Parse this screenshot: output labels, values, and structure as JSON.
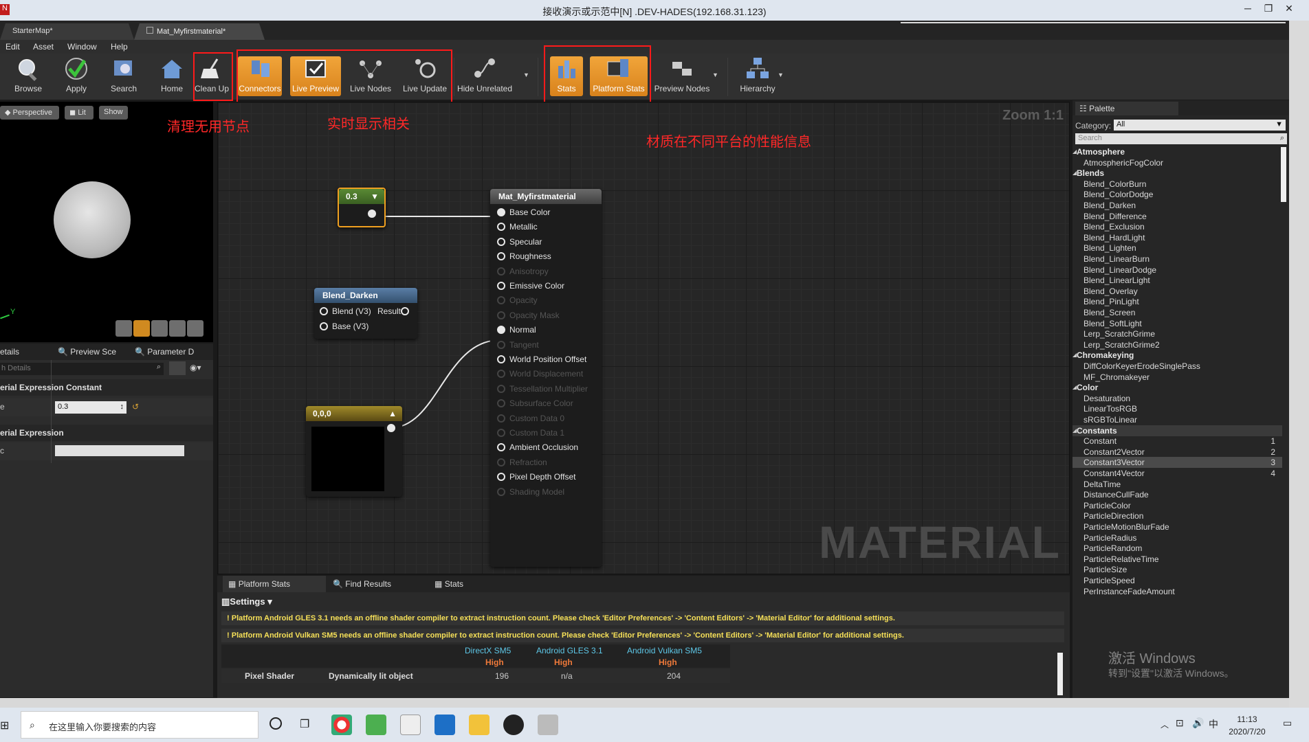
{
  "window": {
    "title": "接收演示或示范中[N] .DEV-HADES(192.168.31.123)"
  },
  "tabs": [
    {
      "label": "StarterMap*"
    },
    {
      "label": "Mat_Myfirstmaterial*"
    }
  ],
  "menu": [
    "Edit",
    "Asset",
    "Window",
    "Help"
  ],
  "toolbar": {
    "browse": "Browse",
    "apply": "Apply",
    "search": "Search",
    "home": "Home",
    "clean_up": "Clean Up",
    "connectors": "Connectors",
    "live_preview": "Live Preview",
    "live_nodes": "Live Nodes",
    "live_update": "Live Update",
    "hide_unrelated": "Hide Unrelated",
    "stats": "Stats",
    "platform_stats": "Platform Stats",
    "preview_nodes": "Preview Nodes",
    "hierarchy": "Hierarchy"
  },
  "annotations": {
    "clean": "清理无用节点",
    "live": "实时显示相关",
    "platform": "材质在不同平台的性能信息"
  },
  "viewport": {
    "perspective": "Perspective",
    "lit": "Lit",
    "show": "Show",
    "axis": "Y"
  },
  "details": {
    "tab_details": "etails",
    "tab_preview": "Preview Sce",
    "tab_param": "Parameter D",
    "search_placeholder": "h Details",
    "section1": "erial Expression Constant",
    "row_label": "e",
    "value": "0.3",
    "section2": "erial Expression",
    "row2_label": "c"
  },
  "graph": {
    "zoom": "Zoom 1:1",
    "watermark": "MATERIAL",
    "const_node": {
      "value": "0.3"
    },
    "blend_node": {
      "title": "Blend_Darken",
      "pins": [
        "Blend (V3)",
        "Result",
        "Base (V3)"
      ]
    },
    "vec_node": {
      "title": "0,0,0"
    },
    "material_node": {
      "title": "Mat_Myfirstmaterial",
      "pins": [
        {
          "label": "Base Color",
          "active": true
        },
        {
          "label": "Metallic",
          "active": true
        },
        {
          "label": "Specular",
          "active": true
        },
        {
          "label": "Roughness",
          "active": true
        },
        {
          "label": "Anisotropy",
          "active": false
        },
        {
          "label": "Emissive Color",
          "active": true
        },
        {
          "label": "Opacity",
          "active": false
        },
        {
          "label": "Opacity Mask",
          "active": false
        },
        {
          "label": "Normal",
          "active": true
        },
        {
          "label": "Tangent",
          "active": false
        },
        {
          "label": "World Position Offset",
          "active": true
        },
        {
          "label": "World Displacement",
          "active": false
        },
        {
          "label": "Tessellation Multiplier",
          "active": false
        },
        {
          "label": "Subsurface Color",
          "active": false
        },
        {
          "label": "Custom Data 0",
          "active": false
        },
        {
          "label": "Custom Data 1",
          "active": false
        },
        {
          "label": "Ambient Occlusion",
          "active": true
        },
        {
          "label": "Refraction",
          "active": false
        },
        {
          "label": "Pixel Depth Offset",
          "active": true
        },
        {
          "label": "Shading Model",
          "active": false
        }
      ]
    }
  },
  "bottom": {
    "tabs": [
      "Platform Stats",
      "Find Results",
      "Stats"
    ],
    "settings": "Settings",
    "warnings": [
      "Platform Android GLES 3.1 needs an offline shader compiler to extract instruction count. Please check 'Editor Preferences' -> 'Content Editors' -> 'Material Editor' for additional settings.",
      "Platform Android Vulkan SM5 needs an offline shader compiler to extract instruction count. Please check 'Editor Preferences' -> 'Content Editors' -> 'Material Editor' for additional settings."
    ],
    "columns": [
      "DirectX SM5",
      "Android GLES 3.1",
      "Android Vulkan SM5"
    ],
    "quality": "High",
    "row": {
      "label": "Pixel Shader",
      "desc": "Dynamically lit object",
      "values": [
        "196",
        "n/a",
        "204"
      ]
    }
  },
  "palette": {
    "title": "Palette",
    "category_label": "Category:",
    "category": "All",
    "search_placeholder": "Search",
    "entries": [
      {
        "t": "c",
        "n": "Atmosphere"
      },
      {
        "t": "i",
        "n": "AtmosphericFogColor"
      },
      {
        "t": "c",
        "n": "Blends"
      },
      {
        "t": "i",
        "n": "Blend_ColorBurn"
      },
      {
        "t": "i",
        "n": "Blend_ColorDodge"
      },
      {
        "t": "i",
        "n": "Blend_Darken"
      },
      {
        "t": "i",
        "n": "Blend_Difference"
      },
      {
        "t": "i",
        "n": "Blend_Exclusion"
      },
      {
        "t": "i",
        "n": "Blend_HardLight"
      },
      {
        "t": "i",
        "n": "Blend_Lighten"
      },
      {
        "t": "i",
        "n": "Blend_LinearBurn"
      },
      {
        "t": "i",
        "n": "Blend_LinearDodge"
      },
      {
        "t": "i",
        "n": "Blend_LinearLight"
      },
      {
        "t": "i",
        "n": "Blend_Overlay"
      },
      {
        "t": "i",
        "n": "Blend_PinLight"
      },
      {
        "t": "i",
        "n": "Blend_Screen"
      },
      {
        "t": "i",
        "n": "Blend_SoftLight"
      },
      {
        "t": "i",
        "n": "Lerp_ScratchGrime"
      },
      {
        "t": "i",
        "n": "Lerp_ScratchGrime2"
      },
      {
        "t": "c",
        "n": "Chromakeying"
      },
      {
        "t": "i",
        "n": "DiffColorKeyerErodeSinglePass"
      },
      {
        "t": "i",
        "n": "MF_Chromakeyer"
      },
      {
        "t": "c",
        "n": "Color"
      },
      {
        "t": "i",
        "n": "Desaturation"
      },
      {
        "t": "i",
        "n": "LinearTosRGB"
      },
      {
        "t": "i",
        "n": "sRGBToLinear"
      },
      {
        "t": "c",
        "n": "Constants",
        "sel": true
      },
      {
        "t": "i",
        "n": "Constant",
        "k": "1"
      },
      {
        "t": "i",
        "n": "Constant2Vector",
        "k": "2"
      },
      {
        "t": "i",
        "n": "Constant3Vector",
        "k": "3",
        "sel": true
      },
      {
        "t": "i",
        "n": "Constant4Vector",
        "k": "4"
      },
      {
        "t": "i",
        "n": "DeltaTime"
      },
      {
        "t": "i",
        "n": "DistanceCullFade"
      },
      {
        "t": "i",
        "n": "ParticleColor"
      },
      {
        "t": "i",
        "n": "ParticleDirection"
      },
      {
        "t": "i",
        "n": "ParticleMotionBlurFade"
      },
      {
        "t": "i",
        "n": "ParticleRadius"
      },
      {
        "t": "i",
        "n": "ParticleRandom"
      },
      {
        "t": "i",
        "n": "ParticleRelativeTime"
      },
      {
        "t": "i",
        "n": "ParticleSize"
      },
      {
        "t": "i",
        "n": "ParticleSpeed"
      },
      {
        "t": "i",
        "n": "PerInstanceFadeAmount"
      }
    ]
  },
  "activation": {
    "line1": "激活 Windows",
    "line2": "转到\"设置\"以激活 Windows。"
  },
  "taskbar": {
    "search_placeholder": "在这里输入你要搜索的内容",
    "time": "11:13",
    "date": "2020/7/20",
    "ime": "中"
  },
  "colors": {
    "accent_orange": "#e8962a",
    "red_annotation": "#ff2020",
    "node_green": "#4f7a2a",
    "node_blue": "#3c5a7a",
    "node_gold": "#8a7420"
  }
}
